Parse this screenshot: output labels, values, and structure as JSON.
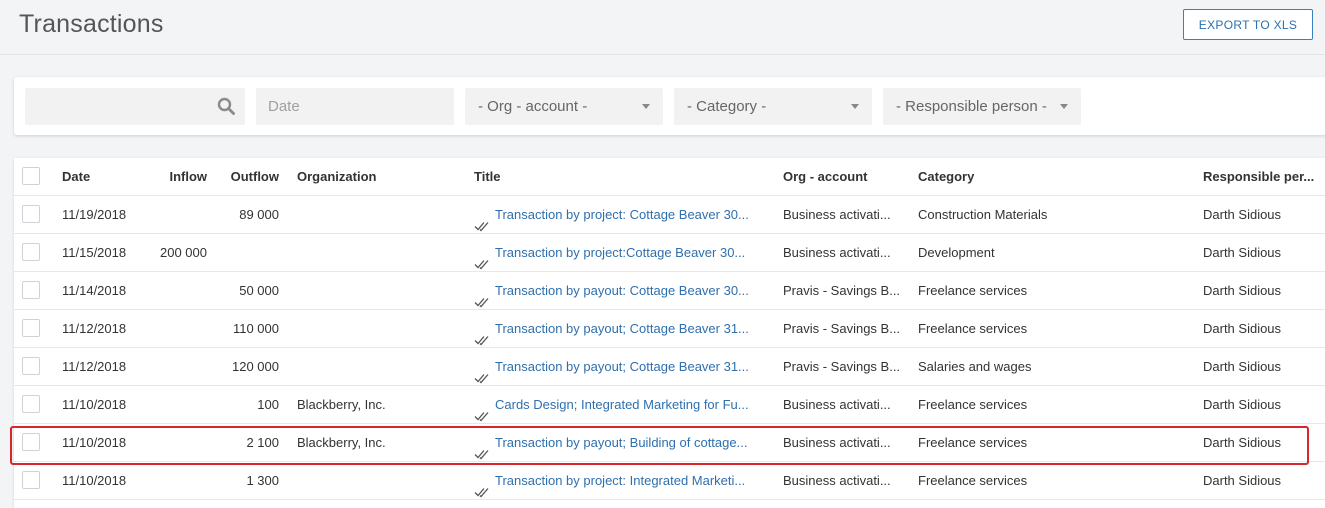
{
  "header": {
    "title": "Transactions",
    "export_label": "EXPORT TO XLS"
  },
  "filters": {
    "search_value": "",
    "date_placeholder": "Date",
    "org_account": "- Org - account -",
    "category": "- Category -",
    "responsible": "- Responsible person -"
  },
  "table": {
    "columns": {
      "date": "Date",
      "inflow": "Inflow",
      "outflow": "Outflow",
      "organization": "Organization",
      "title": "Title",
      "org_account": "Org - account",
      "category": "Category",
      "responsible": "Responsible per..."
    },
    "rows": [
      {
        "date": "11/19/2018",
        "inflow": "",
        "outflow": "89 000",
        "organization": "",
        "title": "Transaction by project: Cottage Beaver 30...",
        "org_account": "Business activati...",
        "category": "Construction Materials",
        "responsible": "Darth Sidious"
      },
      {
        "date": "11/15/2018",
        "inflow": "200 000",
        "outflow": "",
        "organization": "",
        "title": "Transaction by project:Cottage Beaver 30...",
        "org_account": "Business activati...",
        "category": "Development",
        "responsible": "Darth Sidious"
      },
      {
        "date": "11/14/2018",
        "inflow": "",
        "outflow": "50 000",
        "organization": "",
        "title": "Transaction by payout: Cottage Beaver 30...",
        "org_account": "Pravis - Savings B...",
        "category": "Freelance services",
        "responsible": "Darth Sidious"
      },
      {
        "date": "11/12/2018",
        "inflow": "",
        "outflow": "110 000",
        "organization": "",
        "title": "Transaction by payout; Cottage Beaver 31...",
        "org_account": "Pravis - Savings B...",
        "category": "Freelance services",
        "responsible": "Darth Sidious"
      },
      {
        "date": "11/12/2018",
        "inflow": "",
        "outflow": "120 000",
        "organization": "",
        "title": "Transaction by payout; Cottage Beaver 31...",
        "org_account": "Pravis - Savings B...",
        "category": "Salaries and wages",
        "responsible": "Darth Sidious"
      },
      {
        "date": "11/10/2018",
        "inflow": "",
        "outflow": "100",
        "organization": "Blackberry, Inc.",
        "title": "Cards Design; Integrated Marketing for Fu...",
        "org_account": "Business activati...",
        "category": "Freelance services",
        "responsible": "Darth Sidious"
      },
      {
        "date": "11/10/2018",
        "inflow": "",
        "outflow": "2 100",
        "organization": "Blackberry, Inc.",
        "title": "Transaction by payout; Building of cottage...",
        "org_account": "Business activati...",
        "category": "Freelance services",
        "responsible": "Darth Sidious"
      },
      {
        "date": "11/10/2018",
        "inflow": "",
        "outflow": "1 300",
        "organization": "",
        "title": "Transaction by project: Integrated Marketi...",
        "org_account": "Business activati...",
        "category": "Freelance services",
        "responsible": "Darth Sidious"
      }
    ]
  },
  "icons": {
    "search": "search-icon",
    "caret": "chevron-down-icon",
    "status": "double-check-icon"
  },
  "colors": {
    "accent": "#2f6fad",
    "highlight": "#d9262c"
  }
}
